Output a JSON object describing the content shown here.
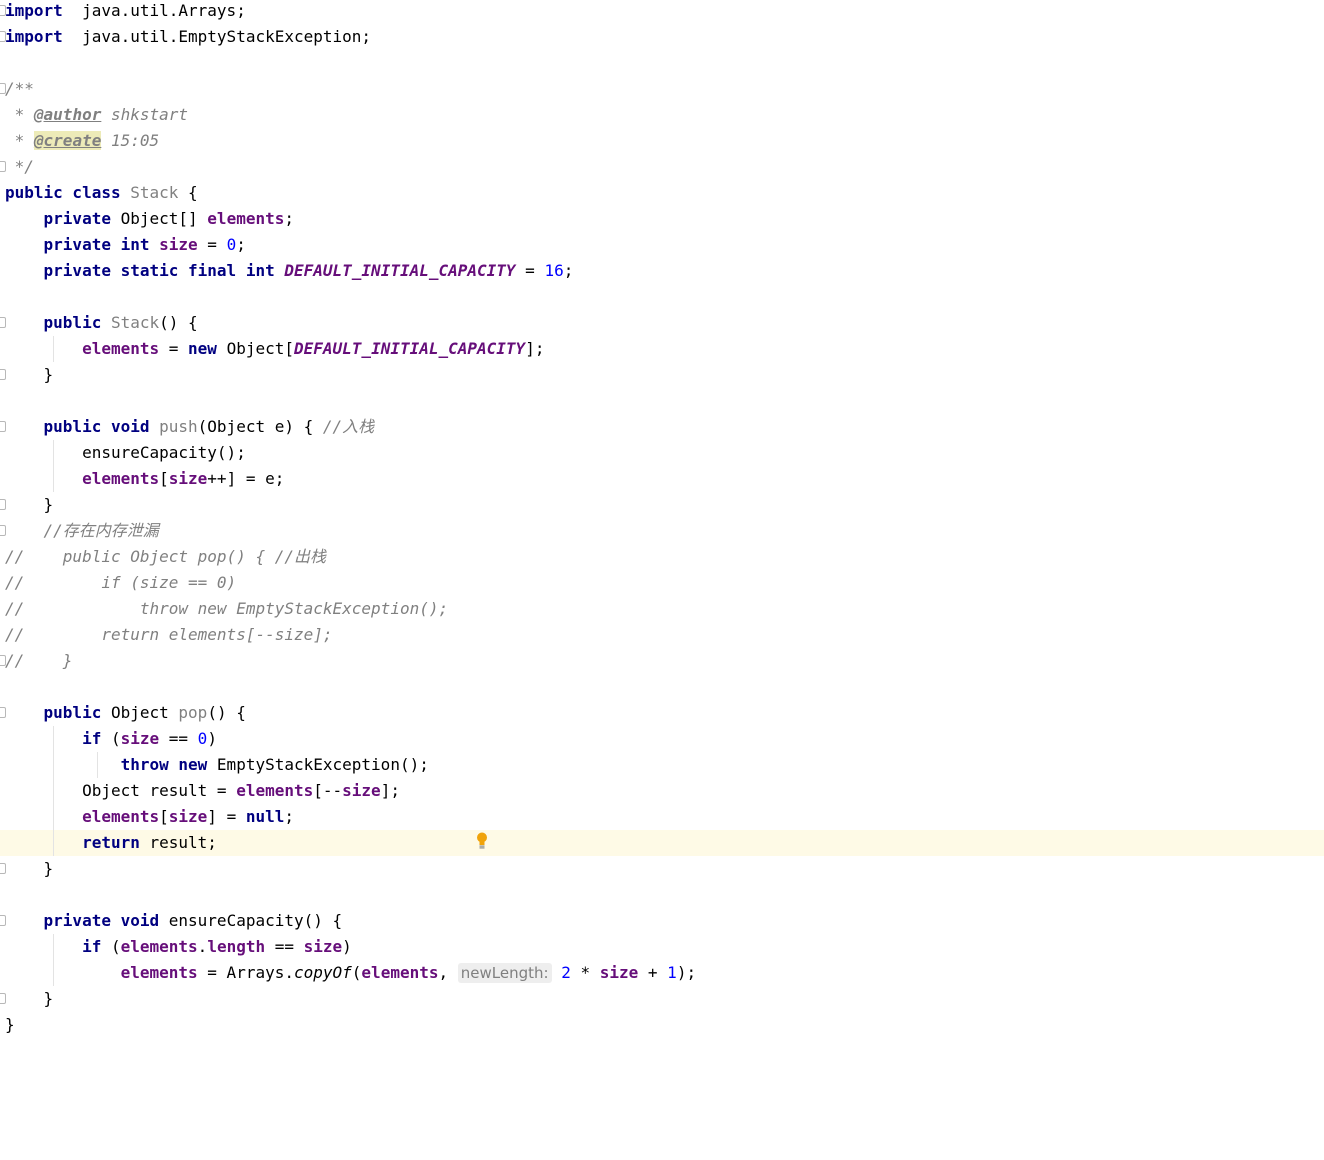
{
  "editor": {
    "file_language": "java",
    "lines": [
      [
        [
          "kw",
          "import"
        ],
        [
          "",
          "  java.util.Arrays;"
        ]
      ],
      [
        [
          "kw",
          "import"
        ],
        [
          "",
          "  java.util.EmptyStackException;"
        ]
      ],
      [],
      [
        [
          "cmt",
          "/**"
        ]
      ],
      [
        [
          "cmt",
          " * "
        ],
        [
          "tag",
          "@author"
        ],
        [
          "cmt",
          " shkstart"
        ]
      ],
      [
        [
          "cmt",
          " * "
        ],
        [
          "tag hl",
          "@create"
        ],
        [
          "cmt",
          " 15:05"
        ]
      ],
      [
        [
          "cmt",
          " */"
        ]
      ],
      [
        [
          "kw",
          "public class "
        ],
        [
          "muted",
          "Stack"
        ],
        [
          "",
          " {"
        ]
      ],
      [
        [
          "",
          "    "
        ],
        [
          "kw",
          "private "
        ],
        [
          "",
          "Object[] "
        ],
        [
          "fld",
          "elements"
        ],
        [
          "",
          ";"
        ]
      ],
      [
        [
          "",
          "    "
        ],
        [
          "kw",
          "private int "
        ],
        [
          "fld",
          "size"
        ],
        [
          "",
          " = "
        ],
        [
          "num",
          "0"
        ],
        [
          "",
          ";"
        ]
      ],
      [
        [
          "",
          "    "
        ],
        [
          "kw",
          "private static final int "
        ],
        [
          "const",
          "DEFAULT_INITIAL_CAPACITY"
        ],
        [
          "",
          " = "
        ],
        [
          "num",
          "16"
        ],
        [
          "",
          ";"
        ]
      ],
      [],
      [
        [
          "",
          "    "
        ],
        [
          "kw",
          "public "
        ],
        [
          "muted",
          "Stack"
        ],
        [
          "",
          "() {"
        ]
      ],
      [
        [
          "",
          "        "
        ],
        [
          "fld",
          "elements"
        ],
        [
          "",
          " = "
        ],
        [
          "kw",
          "new "
        ],
        [
          "",
          "Object["
        ],
        [
          "const",
          "DEFAULT_INITIAL_CAPACITY"
        ],
        [
          "",
          "];"
        ]
      ],
      [
        [
          "",
          "    }"
        ]
      ],
      [],
      [
        [
          "",
          "    "
        ],
        [
          "kw",
          "public void "
        ],
        [
          "muted",
          "push"
        ],
        [
          "",
          "(Object e) { "
        ],
        [
          "cmt",
          "//入栈"
        ]
      ],
      [
        [
          "",
          "        ensureCapacity();"
        ]
      ],
      [
        [
          "",
          "        "
        ],
        [
          "fld",
          "elements"
        ],
        [
          "",
          "["
        ],
        [
          "fld",
          "size"
        ],
        [
          "",
          "++] = e;"
        ]
      ],
      [
        [
          "",
          "    }"
        ]
      ],
      [
        [
          "cmt",
          "    //存在内存泄漏"
        ]
      ],
      [
        [
          "cmt",
          "//    public Object pop() { //出栈"
        ]
      ],
      [
        [
          "cmt",
          "//        if (size == 0)"
        ]
      ],
      [
        [
          "cmt",
          "//            throw new EmptyStackException();"
        ]
      ],
      [
        [
          "cmt",
          "//        return elements[--size];"
        ]
      ],
      [
        [
          "cmt",
          "//    }"
        ]
      ],
      [],
      [
        [
          "",
          "    "
        ],
        [
          "kw",
          "public "
        ],
        [
          "",
          "Object "
        ],
        [
          "muted",
          "pop"
        ],
        [
          "",
          "() {"
        ]
      ],
      [
        [
          "",
          "        "
        ],
        [
          "kw",
          "if "
        ],
        [
          "",
          "("
        ],
        [
          "fld",
          "size"
        ],
        [
          "",
          " == "
        ],
        [
          "num",
          "0"
        ],
        [
          "",
          ")"
        ]
      ],
      [
        [
          "",
          "            "
        ],
        [
          "kw",
          "throw new "
        ],
        [
          "",
          "EmptyStackException();"
        ]
      ],
      [
        [
          "",
          "        Object result = "
        ],
        [
          "fld",
          "elements"
        ],
        [
          "",
          "[--"
        ],
        [
          "fld",
          "size"
        ],
        [
          "",
          "];"
        ]
      ],
      [
        [
          "",
          "        "
        ],
        [
          "fld",
          "elements"
        ],
        [
          "",
          "["
        ],
        [
          "fld",
          "size"
        ],
        [
          "",
          "] = "
        ],
        [
          "kw",
          "null"
        ],
        [
          "",
          ";"
        ]
      ],
      [
        [
          "",
          "        "
        ],
        [
          "kw",
          "return "
        ],
        [
          "",
          "result;"
        ]
      ],
      [
        [
          "",
          "    }"
        ]
      ],
      [],
      [
        [
          "",
          "    "
        ],
        [
          "kw",
          "private void "
        ],
        [
          "",
          "ensureCapacity() {"
        ]
      ],
      [
        [
          "",
          "        "
        ],
        [
          "kw",
          "if "
        ],
        [
          "",
          "("
        ],
        [
          "fld",
          "elements"
        ],
        [
          "",
          "."
        ],
        [
          "fld",
          "length"
        ],
        [
          "",
          " == "
        ],
        [
          "fld",
          "size"
        ],
        [
          "",
          ")"
        ]
      ],
      [
        [
          "",
          "            "
        ],
        [
          "fld",
          "elements"
        ],
        [
          "",
          " = Arrays."
        ],
        [
          "stat",
          "copyOf"
        ],
        [
          "",
          "("
        ],
        [
          "fld",
          "elements"
        ],
        [
          "",
          ", "
        ],
        [
          "hint",
          "newLength:"
        ],
        [
          "",
          " "
        ],
        [
          "num",
          "2"
        ],
        [
          "",
          " * "
        ],
        [
          "fld",
          "size"
        ],
        [
          "",
          " + "
        ],
        [
          "num",
          "1"
        ],
        [
          "",
          ");"
        ]
      ],
      [
        [
          "",
          "    }"
        ]
      ],
      [
        [
          "",
          "}"
        ]
      ]
    ]
  },
  "colors": {
    "keyword": "#000080",
    "field": "#660e7a",
    "number": "#0000ff",
    "comment": "#808080",
    "current_line": "#fefae6",
    "bulb": "#f0a30a"
  },
  "icons": {
    "fold_marker": "fold-marker-icon",
    "intention": "lightbulb-icon"
  }
}
